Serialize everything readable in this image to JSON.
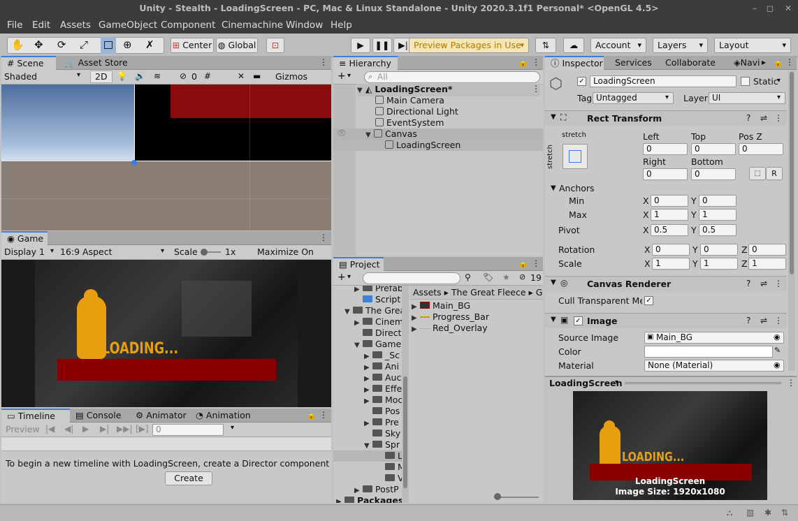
{
  "window": {
    "title": "Unity - Stealth - LoadingScreen - PC, Mac & Linux Standalone - Unity 2020.3.1f1 Personal* <OpenGL 4.5>"
  },
  "menu": [
    "File",
    "Edit",
    "Assets",
    "GameObject",
    "Component",
    "Cinemachine",
    "Window",
    "Help"
  ],
  "toolbar": {
    "center": "Center",
    "global": "Global",
    "preview_packages": "Preview Packages in Use",
    "account": "Account",
    "layers": "Layers",
    "layout": "Layout"
  },
  "scene": {
    "tab": "Scene",
    "asset_store_tab": "Asset Store",
    "shading": "Shaded",
    "mode_2d": "2D",
    "hidden_count": "0",
    "gizmos": "Gizmos"
  },
  "game": {
    "tab": "Game",
    "display": "Display 1",
    "aspect": "16:9 Aspect",
    "scale_label": "Scale",
    "scale_value": "1x",
    "maximize": "Maximize On Play",
    "loading_text": "LOADING..."
  },
  "timeline": {
    "tabs": [
      "Timeline",
      "Console",
      "Animator",
      "Animation"
    ],
    "preview": "Preview",
    "frame": "0",
    "message": "To begin a new timeline with LoadingScreen, create a Director component and a Tir",
    "create_button": "Create"
  },
  "hierarchy": {
    "tab": "Hierarchy",
    "search_placeholder": "All",
    "scene_name": "LoadingScreen*",
    "items": [
      "Main Camera",
      "Directional Light",
      "EventSystem",
      "Canvas",
      "LoadingScreen"
    ]
  },
  "project": {
    "tab": "Project",
    "count": "19",
    "breadcrumb": [
      "Assets",
      "The Great Fleece",
      "Ga"
    ],
    "folders": [
      "Prefab",
      "Script",
      "The Grea",
      "Cinem",
      "Direct",
      "Game",
      "_Sc",
      "Ani",
      "Auc",
      "Effe",
      "Moc",
      "Pos",
      "Pre",
      "Sky",
      "Spr",
      "L",
      "M",
      "V",
      "PostP",
      "Packages"
    ],
    "assets": [
      "Main_BG",
      "Progress_Bar",
      "Red_Overlay"
    ]
  },
  "inspector": {
    "tabs": [
      "Inspector",
      "Services",
      "Collaborate",
      "Navi"
    ],
    "object_name": "LoadingScreen",
    "static_label": "Static",
    "tag_label": "Tag",
    "tag_value": "Untagged",
    "layer_label": "Layer",
    "layer_value": "UI",
    "rect_transform": {
      "title": "Rect Transform",
      "anchor_preset": "stretch",
      "left_label": "Left",
      "left": "0",
      "top_label": "Top",
      "top": "0",
      "posz_label": "Pos Z",
      "posz": "0",
      "right_label": "Right",
      "right": "0",
      "bottom_label": "Bottom",
      "bottom": "0",
      "raw_btn": "R",
      "anchors_label": "Anchors",
      "min_label": "Min",
      "min_x": "0",
      "min_y": "0",
      "max_label": "Max",
      "max_x": "1",
      "max_y": "1",
      "pivot_label": "Pivot",
      "pivot_x": "0.5",
      "pivot_y": "0.5",
      "rotation_label": "Rotation",
      "rot_x": "0",
      "rot_y": "0",
      "rot_z": "0",
      "scale_label": "Scale",
      "scale_x": "1",
      "scale_y": "1",
      "scale_z": "1",
      "x": "X",
      "y": "Y",
      "z": "Z"
    },
    "canvas_renderer": {
      "title": "Canvas Renderer",
      "cull_label": "Cull Transparent Mes"
    },
    "image": {
      "title": "Image",
      "source_label": "Source Image",
      "source_value": "Main_BG",
      "color_label": "Color",
      "material_label": "Material",
      "material_value": "None (Material)"
    },
    "preview": {
      "title": "LoadingScreen",
      "caption": "LoadingScreen",
      "size": "Image Size: 1920x1080",
      "loading_text": "LOADING..."
    }
  }
}
